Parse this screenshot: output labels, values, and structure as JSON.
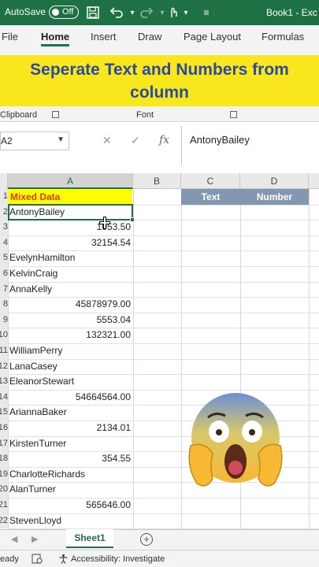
{
  "titlebar": {
    "autosave_label": "AutoSave",
    "autosave_state": "Off",
    "book_title": "Book1 - Exc"
  },
  "ribbon": {
    "tabs": [
      "File",
      "Home",
      "Insert",
      "Draw",
      "Page Layout",
      "Formulas"
    ],
    "active_tab": "Home",
    "groups": [
      "Clipboard",
      "Font"
    ],
    "banner_text": "Seperate Text and Numbers from column"
  },
  "formula_bar": {
    "name_box": "A2",
    "content": "AntonyBailey"
  },
  "grid": {
    "columns": [
      "A",
      "B",
      "C",
      "D"
    ],
    "row_numbers": [
      "1",
      "2",
      "3",
      "4",
      "5",
      "6",
      "7",
      "8",
      "9",
      "10",
      "11",
      "12",
      "13",
      "14",
      "15",
      "16",
      "17",
      "18",
      "19",
      "20",
      "21",
      "22"
    ],
    "header_a": "Mixed Data",
    "header_c": "Text",
    "header_d": "Number",
    "cells_a": [
      {
        "value": "AntonyBailey",
        "type": "text"
      },
      {
        "value": "1053.50",
        "type": "num"
      },
      {
        "value": "32154.54",
        "type": "num"
      },
      {
        "value": "EvelynHamilton",
        "type": "text"
      },
      {
        "value": "KelvinCraig",
        "type": "text"
      },
      {
        "value": "AnnaKelly",
        "type": "text"
      },
      {
        "value": "45878979.00",
        "type": "num"
      },
      {
        "value": "5553.04",
        "type": "num"
      },
      {
        "value": "132321.00",
        "type": "num"
      },
      {
        "value": "WilliamPerry",
        "type": "text"
      },
      {
        "value": "LanaCasey",
        "type": "text"
      },
      {
        "value": "EleanorStewart",
        "type": "text"
      },
      {
        "value": "54664564.00",
        "type": "num"
      },
      {
        "value": "AriannaBaker",
        "type": "text"
      },
      {
        "value": "2134.01",
        "type": "num"
      },
      {
        "value": "KirstenTurner",
        "type": "text"
      },
      {
        "value": "354.55",
        "type": "num"
      },
      {
        "value": "CharlotteRichards",
        "type": "text"
      },
      {
        "value": "AlanTurner",
        "type": "text"
      },
      {
        "value": "565646.00",
        "type": "num"
      },
      {
        "value": "StevenLloyd",
        "type": "text"
      }
    ]
  },
  "sheet_tabs": {
    "active_sheet": "Sheet1",
    "add_label": "+"
  },
  "statusbar": {
    "ready": "eady",
    "accessibility": "Accessibility: Investigate"
  },
  "colors": {
    "excel_green": "#1e7145",
    "banner_yellow": "#f8e71c",
    "banner_text": "#2b4aa0",
    "header_blue": "#8497b0",
    "header_mixed_text": "#e03a1e"
  }
}
